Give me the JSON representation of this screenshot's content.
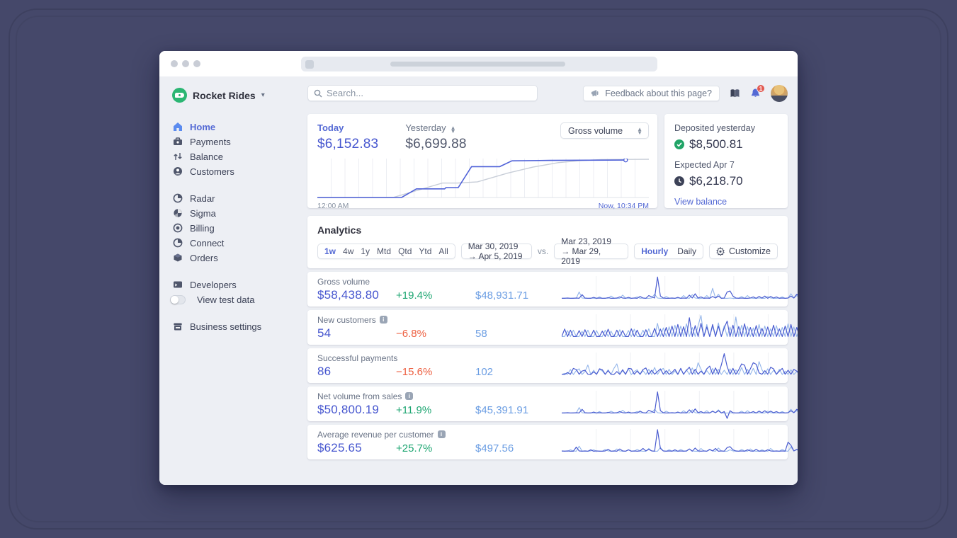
{
  "browser": {
    "url_placeholder": ""
  },
  "sidebar": {
    "brand": {
      "name": "Rocket Rides"
    },
    "items": [
      {
        "label": "Home",
        "active": true
      },
      {
        "label": "Payments"
      },
      {
        "label": "Balance"
      },
      {
        "label": "Customers"
      },
      {
        "label": "Radar"
      },
      {
        "label": "Sigma"
      },
      {
        "label": "Billing"
      },
      {
        "label": "Connect"
      },
      {
        "label": "Orders"
      },
      {
        "label": "Developers"
      },
      {
        "label": "View test data"
      },
      {
        "label": "Business settings"
      }
    ]
  },
  "topbar": {
    "search_placeholder": "Search...",
    "feedback_label": "Feedback about this page?",
    "notification_count": "1"
  },
  "overview": {
    "today": {
      "label": "Today",
      "amount": "$6,152.83"
    },
    "yesterday": {
      "label": "Yesterday",
      "amount": "$6,699.88"
    },
    "metric_select": "Gross volume",
    "axis_start": "12:00 AM",
    "axis_end": "Now, 10:34 PM",
    "chart": {
      "type": "line",
      "today_points": [
        [
          0,
          0
        ],
        [
          25.4,
          0
        ],
        [
          29.9,
          22.6
        ],
        [
          38.4,
          22.6
        ],
        [
          38.8,
          26
        ],
        [
          42.5,
          26
        ],
        [
          46.5,
          80.8
        ],
        [
          55,
          80.8
        ],
        [
          58.7,
          95.9
        ],
        [
          70,
          97
        ],
        [
          93,
          98
        ]
      ],
      "yesterday_points": [
        [
          0,
          0
        ],
        [
          22.8,
          0
        ],
        [
          37.7,
          37.7
        ],
        [
          42.3,
          37.7
        ],
        [
          48.3,
          41
        ],
        [
          57.4,
          63.7
        ],
        [
          65,
          79.5
        ],
        [
          72.6,
          91.1
        ],
        [
          79.5,
          96.6
        ],
        [
          85.7,
          99
        ],
        [
          100,
          101
        ]
      ],
      "colors": {
        "today": "#4f61d8",
        "yesterday": "#c8ced8"
      }
    }
  },
  "deposits": {
    "deposited_label": "Deposited yesterday",
    "deposited_amount": "$8,500.81",
    "expected_label": "Expected Apr 7",
    "expected_amount": "$6,218.70",
    "link": "View balance"
  },
  "analytics": {
    "title": "Analytics",
    "ranges": [
      "1w",
      "4w",
      "1y",
      "Mtd",
      "Qtd",
      "Ytd",
      "All"
    ],
    "active_range": "1w",
    "period": "Mar 30, 2019 → Apr 5, 2019",
    "vs": "vs.",
    "compare_period": "Mar 23, 2019 → Mar 29, 2019",
    "granularity": {
      "hourly": "Hourly",
      "daily": "Daily",
      "active": "Hourly"
    },
    "customize_label": "Customize",
    "colors": {
      "current": "#4a5cd0",
      "previous": "#93b5ea",
      "positive": "#1ea672",
      "negative": "#ed5f40"
    },
    "rows": [
      {
        "label": "Gross volume",
        "info": false,
        "value": "$58,438.80",
        "delta": "+19.4%",
        "delta_dir": "up",
        "compare": "$48,931.71",
        "spark": {
          "cur": [
            2,
            2,
            3,
            2,
            2,
            3,
            2,
            18,
            3,
            2,
            2,
            6,
            2,
            3,
            2,
            2,
            5,
            2,
            2,
            3,
            8,
            3,
            2,
            6,
            2,
            3,
            2,
            10,
            3,
            2,
            14,
            8,
            3,
            96,
            12,
            3,
            2,
            2,
            3,
            2,
            6,
            2,
            3,
            2,
            16,
            3,
            22,
            3,
            8,
            2,
            3,
            2,
            10,
            3,
            12,
            2,
            3,
            30,
            34,
            12,
            3,
            2,
            3,
            2,
            2,
            3,
            8,
            2,
            10,
            3,
            12,
            2,
            10,
            3,
            8,
            2,
            3,
            2,
            3,
            12,
            3,
            20,
            8,
            3
          ],
          "prev": [
            2,
            3,
            2,
            2,
            3,
            2,
            30,
            3,
            2,
            2,
            3,
            2,
            2,
            8,
            2,
            3,
            2,
            12,
            3,
            2,
            2,
            16,
            3,
            2,
            2,
            3,
            8,
            2,
            3,
            2,
            2,
            3,
            20,
            3,
            2,
            2,
            10,
            3,
            2,
            2,
            3,
            2,
            14,
            3,
            2,
            18,
            3,
            2,
            2,
            3,
            14,
            2,
            46,
            3,
            20,
            3,
            2,
            2,
            3,
            2,
            2,
            3,
            10,
            2,
            14,
            3,
            2,
            2,
            3,
            2,
            2,
            10,
            3,
            2,
            2,
            3,
            8,
            2,
            3,
            22,
            3,
            14,
            2,
            3
          ]
        }
      },
      {
        "label": "New customers",
        "info": true,
        "value": "54",
        "delta": "−6.8%",
        "delta_dir": "down",
        "compare": "58",
        "spark": {
          "cur": [
            2,
            35,
            2,
            30,
            2,
            2,
            28,
            2,
            32,
            2,
            2,
            30,
            2,
            2,
            26,
            2,
            34,
            2,
            2,
            30,
            2,
            28,
            2,
            2,
            36,
            2,
            30,
            2,
            2,
            32,
            2,
            2,
            38,
            2,
            35,
            2,
            42,
            2,
            48,
            2,
            55,
            2,
            45,
            2,
            85,
            2,
            50,
            2,
            60,
            2,
            44,
            2,
            55,
            2,
            48,
            2,
            40,
            70,
            2,
            52,
            2,
            46,
            2,
            58,
            2,
            42,
            2,
            50,
            2,
            38,
            2,
            44,
            2,
            52,
            2,
            36,
            2,
            48,
            2,
            55,
            2,
            42,
            2,
            30
          ],
          "prev": [
            2,
            2,
            28,
            2,
            30,
            2,
            2,
            25,
            2,
            30,
            2,
            2,
            28,
            2,
            2,
            30,
            2,
            26,
            2,
            2,
            32,
            2,
            2,
            28,
            2,
            34,
            2,
            2,
            30,
            2,
            36,
            2,
            2,
            60,
            2,
            40,
            2,
            45,
            2,
            52,
            2,
            48,
            2,
            58,
            2,
            42,
            2,
            50,
            95,
            2,
            55,
            2,
            48,
            2,
            62,
            2,
            50,
            2,
            44,
            2,
            88,
            2,
            52,
            2,
            46,
            2,
            40,
            2,
            55,
            2,
            48,
            2,
            36,
            2,
            50,
            2,
            42,
            2,
            58,
            2,
            44,
            2,
            36,
            2
          ]
        }
      },
      {
        "label": "Successful payments",
        "info": false,
        "value": "86",
        "delta": "−15.6%",
        "delta_dir": "down",
        "compare": "102",
        "spark": {
          "cur": [
            4,
            3,
            12,
            4,
            30,
            25,
            4,
            18,
            22,
            4,
            3,
            15,
            4,
            28,
            24,
            4,
            20,
            4,
            3,
            16,
            4,
            24,
            4,
            30,
            28,
            4,
            18,
            4,
            25,
            32,
            4,
            22,
            4,
            16,
            28,
            4,
            20,
            4,
            12,
            26,
            4,
            30,
            4,
            22,
            35,
            4,
            26,
            4,
            18,
            4,
            28,
            40,
            4,
            32,
            4,
            45,
            95,
            38,
            4,
            30,
            4,
            24,
            50,
            44,
            4,
            28,
            55,
            48,
            10,
            4,
            20,
            4,
            35,
            28,
            4,
            18,
            30,
            4,
            22,
            4,
            26,
            18,
            4,
            10
          ],
          "prev": [
            3,
            8,
            4,
            25,
            3,
            20,
            28,
            3,
            16,
            45,
            3,
            22,
            3,
            26,
            18,
            3,
            24,
            3,
            30,
            50,
            3,
            20,
            3,
            28,
            3,
            16,
            24,
            3,
            20,
            3,
            26,
            3,
            34,
            3,
            22,
            30,
            3,
            26,
            3,
            18,
            3,
            28,
            3,
            24,
            3,
            32,
            3,
            55,
            26,
            3,
            20,
            3,
            30,
            3,
            26,
            3,
            22,
            3,
            28,
            3,
            24,
            3,
            34,
            3,
            26,
            3,
            30,
            3,
            60,
            24,
            3,
            28,
            3,
            22,
            3,
            26,
            3,
            18,
            3,
            24,
            3,
            16,
            3,
            8
          ]
        }
      },
      {
        "label": "Net volume from sales",
        "info": true,
        "value": "$50,800.19",
        "delta": "+11.9%",
        "delta_dir": "up",
        "compare": "$45,391.91",
        "spark": {
          "cur": [
            2,
            2,
            3,
            2,
            2,
            3,
            2,
            18,
            3,
            2,
            2,
            6,
            2,
            3,
            2,
            2,
            5,
            2,
            2,
            3,
            8,
            3,
            2,
            6,
            2,
            3,
            2,
            10,
            3,
            2,
            14,
            8,
            3,
            95,
            12,
            3,
            2,
            2,
            3,
            2,
            6,
            2,
            3,
            2,
            16,
            3,
            20,
            3,
            8,
            2,
            3,
            2,
            10,
            3,
            12,
            2,
            8,
            -35,
            12,
            3,
            2,
            2,
            3,
            2,
            2,
            3,
            8,
            2,
            10,
            3,
            12,
            2,
            10,
            3,
            8,
            2,
            3,
            2,
            3,
            12,
            3,
            18,
            8,
            3
          ],
          "prev": [
            2,
            3,
            2,
            2,
            3,
            2,
            26,
            3,
            2,
            2,
            3,
            2,
            2,
            8,
            2,
            3,
            2,
            10,
            3,
            2,
            2,
            14,
            3,
            2,
            2,
            3,
            8,
            2,
            3,
            2,
            2,
            3,
            18,
            3,
            2,
            2,
            10,
            3,
            2,
            2,
            3,
            2,
            12,
            3,
            2,
            16,
            3,
            2,
            2,
            3,
            12,
            2,
            8,
            3,
            16,
            3,
            2,
            2,
            3,
            2,
            2,
            3,
            10,
            2,
            12,
            3,
            2,
            2,
            3,
            2,
            2,
            10,
            3,
            2,
            2,
            3,
            8,
            2,
            3,
            18,
            3,
            12,
            2,
            3
          ]
        }
      },
      {
        "label": "Average revenue per customer",
        "info": true,
        "value": "$625.65",
        "delta": "+25.7%",
        "delta_dir": "up",
        "compare": "$497.56",
        "spark": {
          "cur": [
            3,
            2,
            3,
            2,
            2,
            20,
            3,
            2,
            3,
            2,
            8,
            2,
            3,
            2,
            2,
            3,
            10,
            2,
            3,
            2,
            12,
            3,
            2,
            8,
            2,
            3,
            2,
            3,
            14,
            3,
            10,
            3,
            2,
            97,
            14,
            3,
            2,
            3,
            2,
            8,
            2,
            3,
            2,
            3,
            12,
            2,
            16,
            3,
            2,
            3,
            2,
            10,
            3,
            14,
            2,
            3,
            2,
            18,
            22,
            8,
            3,
            2,
            3,
            2,
            8,
            3,
            2,
            10,
            2,
            3,
            2,
            8,
            3,
            2,
            3,
            2,
            3,
            2,
            42,
            28,
            3,
            10,
            2,
            3
          ],
          "prev": [
            2,
            3,
            2,
            8,
            3,
            2,
            24,
            3,
            2,
            2,
            3,
            8,
            2,
            3,
            2,
            10,
            3,
            2,
            2,
            12,
            3,
            2,
            2,
            8,
            3,
            2,
            10,
            3,
            2,
            2,
            14,
            3,
            2,
            2,
            18,
            3,
            2,
            8,
            3,
            2,
            2,
            10,
            3,
            2,
            12,
            3,
            2,
            2,
            14,
            3,
            2,
            8,
            3,
            2,
            16,
            3,
            2,
            2,
            8,
            3,
            2,
            2,
            10,
            3,
            2,
            12,
            3,
            2,
            2,
            8,
            3,
            2,
            14,
            3,
            2,
            2,
            10,
            3,
            2,
            20,
            3,
            8,
            3,
            2
          ]
        }
      }
    ]
  }
}
